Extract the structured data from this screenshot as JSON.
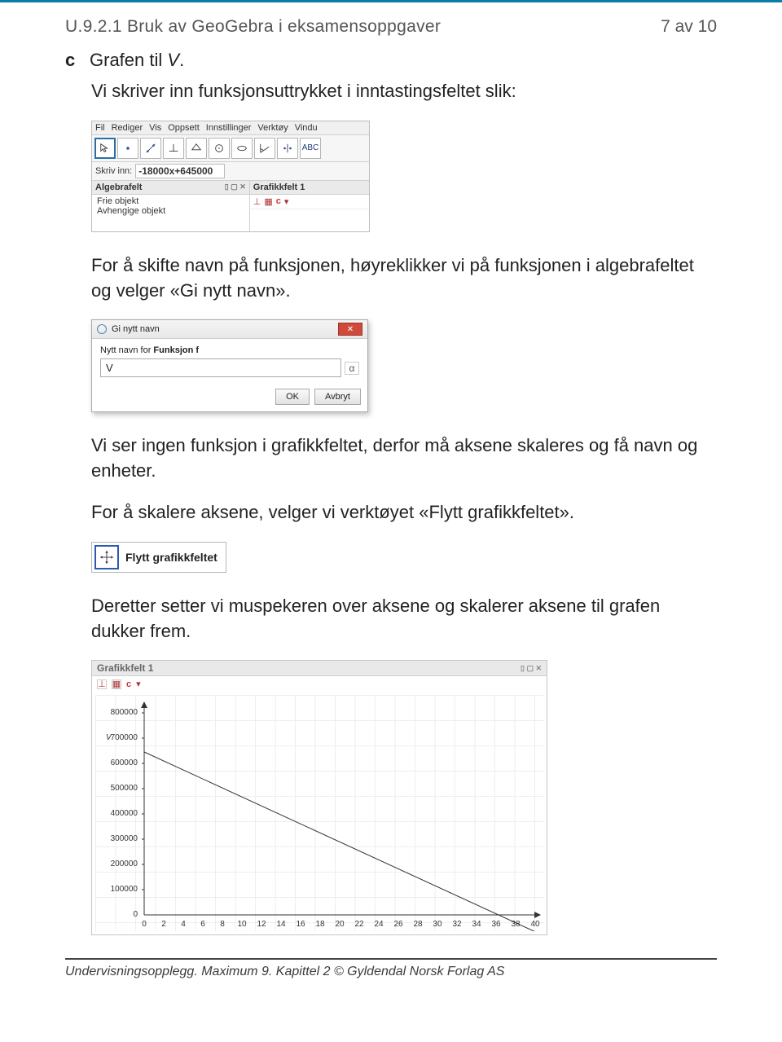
{
  "header": {
    "label": "U.9.2.1   Bruk av GeoGebra i eksamensoppgaver",
    "pagenum": "7 av 10"
  },
  "problem": {
    "letter": "c",
    "prefix": "Grafen til ",
    "variable": "V",
    "suffix": "."
  },
  "para1": "Vi skriver inn funksjonsuttrykket i inntastingsfeltet slik:",
  "geowin": {
    "menu": {
      "fil": "Fil",
      "rediger": "Rediger",
      "vis": "Vis",
      "oppsett": "Oppsett",
      "innst": "Innstillinger",
      "verkt": "Verktøy",
      "vindu": "Vindu"
    },
    "input_label": "Skriv inn:",
    "input_value": "-18000x+645000",
    "algebra_title": "Algebrafelt",
    "algebra_frie": "Frie objekt",
    "algebra_avh": "Avhengige objekt",
    "grafikk_title": "Grafikkfelt 1",
    "abc": "ABC"
  },
  "para2": "For å skifte navn på funksjonen, høyreklikker vi på funksjonen i algebrafeltet og velger «Gi nytt navn».",
  "dialog": {
    "title": "Gi nytt navn",
    "label_prefix": "Nytt navn for ",
    "label_bold": "Funksjon f",
    "value": "V",
    "alpha": "α",
    "ok": "OK",
    "cancel": "Avbryt"
  },
  "para3": "Vi ser ingen funksjon i grafikkfeltet, derfor må aksene skaleres og få navn og enheter.",
  "para4": "For å skalere aksene, velger vi verktøyet «Flytt grafikkfeltet».",
  "flytt": {
    "label": "Flytt grafikkfeltet"
  },
  "para5": "Deretter setter vi muspekeren over aksene og skalerer aksene til grafen dukker frem.",
  "graph": {
    "title": "Grafikkfelt 1",
    "tools_c": "c",
    "ylabel": "V",
    "yticks": [
      "0",
      "100000",
      "200000",
      "300000",
      "400000",
      "500000",
      "600000",
      "700000",
      "800000"
    ],
    "xticks": [
      "0",
      "2",
      "4",
      "6",
      "8",
      "10",
      "12",
      "14",
      "16",
      "18",
      "20",
      "22",
      "24",
      "26",
      "28",
      "30",
      "32",
      "34",
      "36",
      "38",
      "40"
    ]
  },
  "chart_data": {
    "type": "line",
    "title": "Grafikkfelt 1",
    "xlabel": "",
    "ylabel": "V",
    "xlim": [
      0,
      40
    ],
    "ylim": [
      0,
      800000
    ],
    "xticks": [
      0,
      2,
      4,
      6,
      8,
      10,
      12,
      14,
      16,
      18,
      20,
      22,
      24,
      26,
      28,
      30,
      32,
      34,
      36,
      38,
      40
    ],
    "yticks": [
      0,
      100000,
      200000,
      300000,
      400000,
      500000,
      600000,
      700000,
      800000
    ],
    "series": [
      {
        "name": "V",
        "formula": "V(x) = -18000x + 645000",
        "x": [
          0,
          35.8333
        ],
        "values": [
          645000,
          0
        ]
      }
    ]
  },
  "footer": "Undervisningsopplegg. Maximum 9. Kapittel 2 © Gyldendal Norsk Forlag AS"
}
